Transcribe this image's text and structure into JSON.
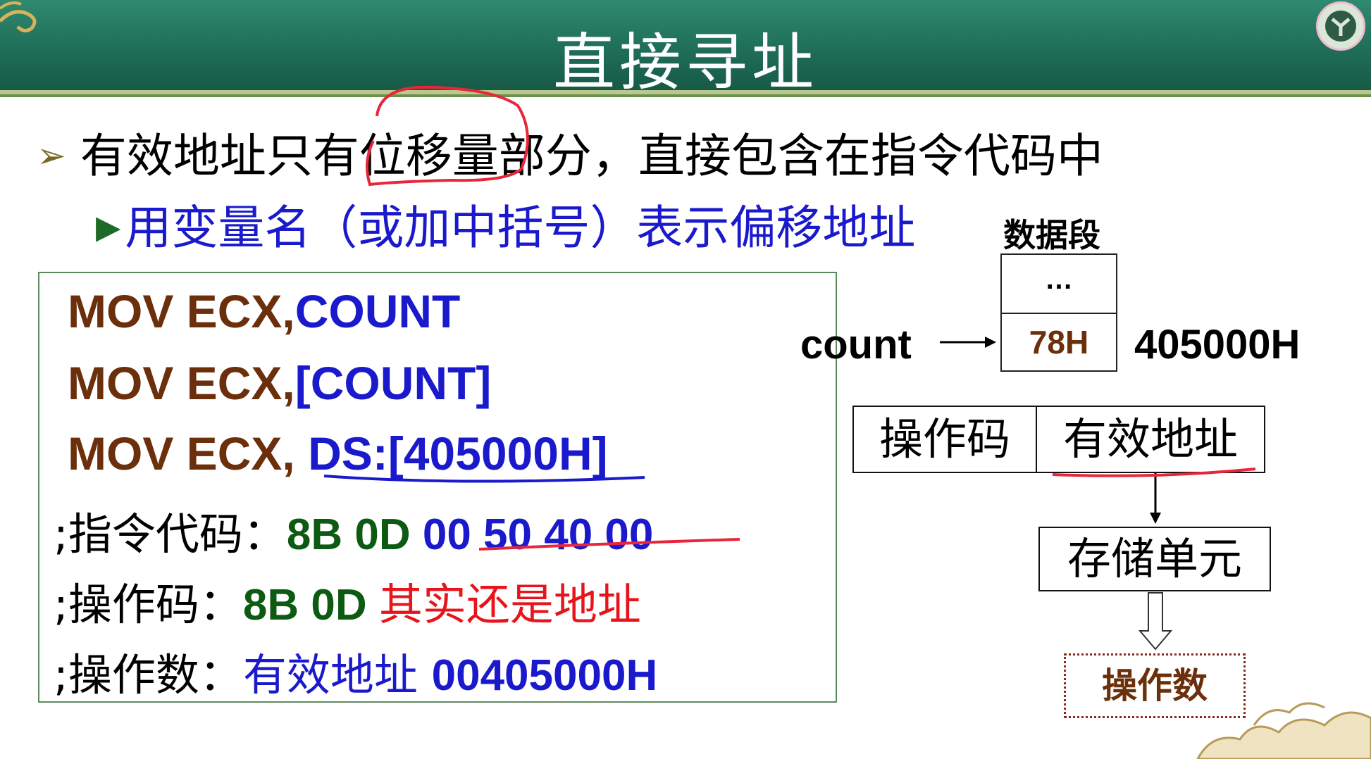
{
  "slide": {
    "title": "直接寻址",
    "bullet1": "有效地址只有位移量部分，直接包含在指令代码中",
    "bullet2": "用变量名（或加中括号）表示偏移地址"
  },
  "code": {
    "line1": {
      "op": "MOV ECX,",
      "arg": "COUNT"
    },
    "line2": {
      "op": "MOV ECX,",
      "arg": "[COUNT]"
    },
    "line3": {
      "op": "MOV ECX, ",
      "arg": "DS:[405000H]"
    },
    "line4": {
      "label": ";指令代码：",
      "opcode": "8B 0D ",
      "addr": "00 50 40 00"
    },
    "line5": {
      "label": ";操作码：",
      "opcode": "8B 0D ",
      "note": "其实还是地址"
    },
    "line6": {
      "label": ";操作数：",
      "ea_text": "有效地址 ",
      "ea_value": "00405000H"
    }
  },
  "diagram": {
    "segment_label": "数据段",
    "cell_top": "…",
    "cell_value": "78H",
    "var_label": "count",
    "address": "405000H",
    "opcode_field": "操作码",
    "ea_field": "有效地址",
    "storage": "存储单元",
    "operand": "操作数"
  },
  "colors": {
    "header": "#1f6e57",
    "mnemonic": "#6b2f0b",
    "operand_blue": "#1a1acc",
    "opcode_green": "#0d5b12",
    "annotation_red": "#e8141b"
  }
}
